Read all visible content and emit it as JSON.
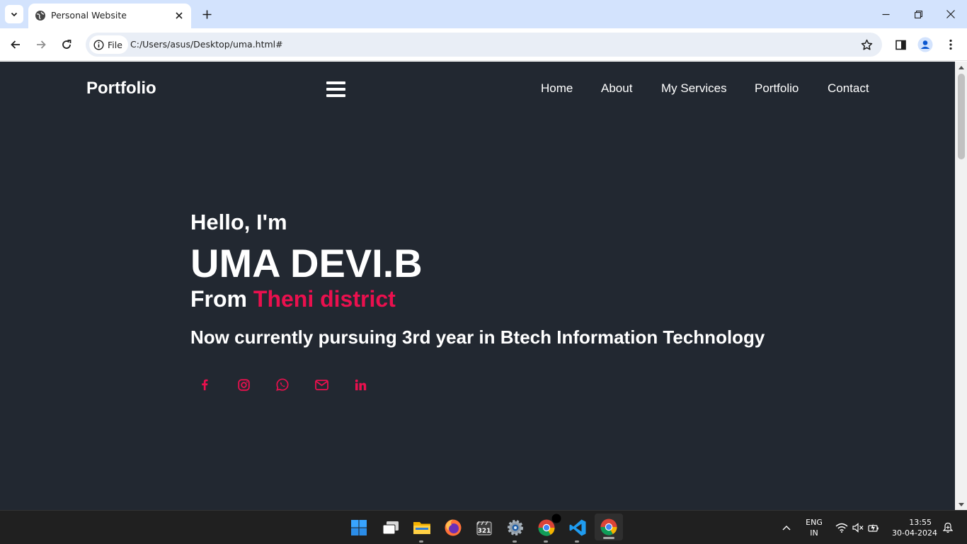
{
  "browser": {
    "tab_title": "Personal Website",
    "chip_label": "File",
    "url": "C:/Users/asus/Desktop/uma.html#"
  },
  "site": {
    "logo": "Portfolio",
    "nav": [
      "Home",
      "About",
      "My Services",
      "Portfolio",
      "Contact"
    ],
    "hero": {
      "greeting": "Hello, I'm",
      "name": "UMA DEVI.B",
      "from_prefix": "From",
      "from_place": "Theni district",
      "description": "Now currently pursuing 3rd year in Btech Information Technology"
    },
    "social_icons": [
      "facebook-icon",
      "instagram-icon",
      "whatsapp-icon",
      "mail-icon",
      "linkedin-icon"
    ],
    "colors": {
      "background": "#222831",
      "accent": "#ea104e",
      "text": "#ffffff"
    }
  },
  "taskbar": {
    "apps": [
      "windows-start-icon",
      "task-view-icon",
      "file-explorer-icon",
      "firefox-icon",
      "media-player-classic-icon",
      "settings-icon",
      "chrome-icon",
      "vscode-icon",
      "chrome-icon"
    ],
    "language": "ENG",
    "region": "IN",
    "time": "13:55",
    "date": "30-04-2024"
  }
}
